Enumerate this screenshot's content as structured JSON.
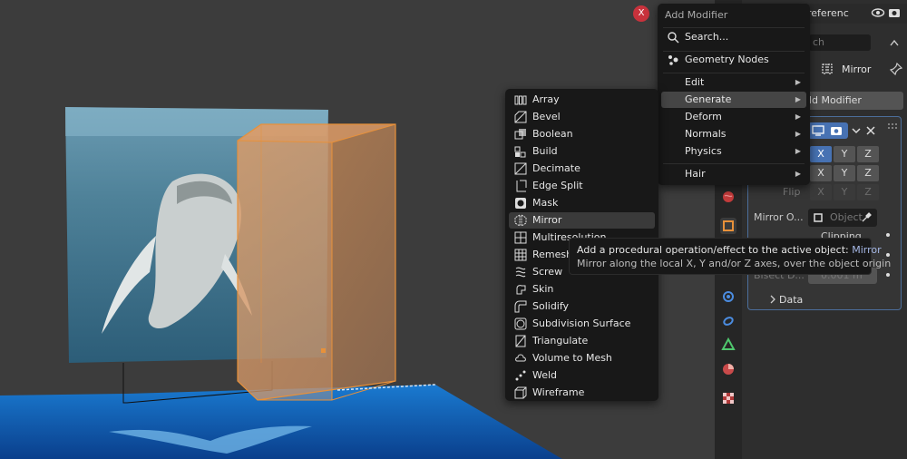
{
  "add_modifier_menu": {
    "title": "Add Modifier",
    "close_glyph": "X",
    "search_label": "Search...",
    "geometry_nodes_label": "Geometry Nodes",
    "items": [
      {
        "label": "Edit"
      },
      {
        "label": "Generate"
      },
      {
        "label": "Deform"
      },
      {
        "label": "Normals"
      },
      {
        "label": "Physics"
      },
      {
        "label": "Hair"
      }
    ]
  },
  "generate_menu": {
    "items": [
      {
        "label": "Array",
        "icon": "array-icon"
      },
      {
        "label": "Bevel",
        "icon": "bevel-icon"
      },
      {
        "label": "Boolean",
        "icon": "boolean-icon"
      },
      {
        "label": "Build",
        "icon": "build-icon"
      },
      {
        "label": "Decimate",
        "icon": "decimate-icon"
      },
      {
        "label": "Edge Split",
        "icon": "edge-split-icon"
      },
      {
        "label": "Mask",
        "icon": "mask-icon"
      },
      {
        "label": "Mirror",
        "icon": "mirror-icon"
      },
      {
        "label": "Multiresolution",
        "icon": "multires-icon"
      },
      {
        "label": "Remesh",
        "icon": "remesh-icon"
      },
      {
        "label": "Screw",
        "icon": "screw-icon"
      },
      {
        "label": "Skin",
        "icon": "skin-icon"
      },
      {
        "label": "Solidify",
        "icon": "solidify-icon"
      },
      {
        "label": "Subdivision Surface",
        "icon": "subsurf-icon"
      },
      {
        "label": "Triangulate",
        "icon": "triangulate-icon"
      },
      {
        "label": "Volume to Mesh",
        "icon": "volume-to-mesh-icon"
      },
      {
        "label": "Weld",
        "icon": "weld-icon"
      },
      {
        "label": "Wireframe",
        "icon": "wireframe-icon"
      }
    ]
  },
  "tooltip": {
    "line1_prefix": "Add a procedural operation/effect to the active object:",
    "line1_value": "Mirror",
    "line2": "Mirror along the local X, Y and/or Z axes, over the object origin"
  },
  "properties": {
    "top_label": "referenc",
    "search_placeholder": "ch",
    "object_name": "Mirror",
    "add_modifier_label": "dd Modifier",
    "axes": [
      "X",
      "Y",
      "Z"
    ],
    "flip_label": "Flip",
    "mirror_object_label": "Mirror O...",
    "mirror_object_placeholder": "Object",
    "clipping_label": "Clipping",
    "data_label": "Data",
    "merge_value": "0.001 m",
    "bisect_label": "Bisect D..."
  },
  "colors": {
    "accent": "#4772b3",
    "selection_orange": "#e8913a",
    "close_red": "#c8323c",
    "tooltip_value": "#a6b8e6"
  }
}
